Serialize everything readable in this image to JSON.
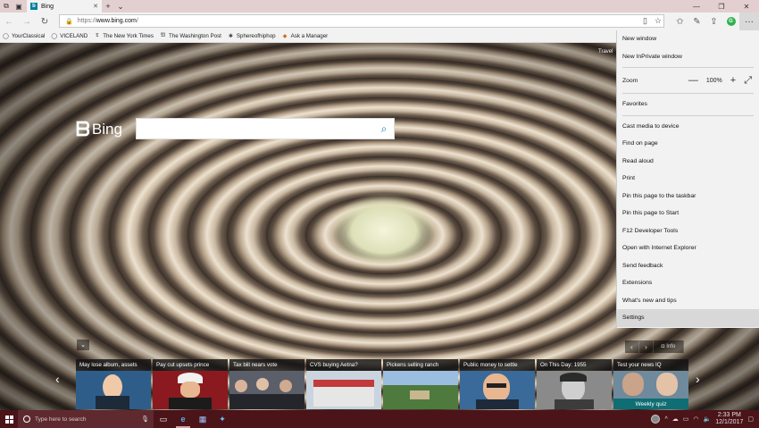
{
  "browser": {
    "tab": {
      "title": "Bing"
    },
    "address": {
      "proto": "https://",
      "host": "www.bing.com",
      "path": "/"
    },
    "favorites": [
      {
        "label": "YourClassical",
        "icon": "globe-icon"
      },
      {
        "label": "VICELAND",
        "icon": "globe-icon"
      },
      {
        "label": "The New York Times",
        "icon": "nyt-icon"
      },
      {
        "label": "The Washington Post",
        "icon": "wapo-icon"
      },
      {
        "label": "Sphereofhiphop",
        "icon": "star-icon"
      },
      {
        "label": "Ask a Manager",
        "icon": "ask-manager-icon"
      }
    ]
  },
  "bing": {
    "logo_text": "Bing",
    "search_placeholder": "",
    "travel_label": "Travel",
    "info_label": "Info",
    "news": [
      {
        "title": "May lose album, assets",
        "bg": "#2e5d8a",
        "accent": "#f0c9a8"
      },
      {
        "title": "Pay cut upsets prince",
        "bg": "#8a1a1f",
        "accent": "#d9d9d9"
      },
      {
        "title": "Tax bill nears vote",
        "bg": "#5b5f6a",
        "accent": "#2b2b2b"
      },
      {
        "title": "CVS buying Aetna?",
        "bg": "#c23a3a",
        "accent": "#e8e8e8"
      },
      {
        "title": "Pickens selling ranch",
        "bg": "#4e7a3e",
        "accent": "#9bbde0"
      },
      {
        "title": "Public money to settle",
        "bg": "#3a6a9a",
        "accent": "#e8b690"
      },
      {
        "title": "On This Day: 1955",
        "bg": "#8a8a8a",
        "accent": "#3c3c3c"
      },
      {
        "title": "Test your news IQ",
        "bg": "#6f8a9c",
        "accent": "#c9a48a"
      }
    ],
    "quiz_badge": "Weekly quiz"
  },
  "menu": {
    "group1": [
      "New window",
      "New InPrivate window"
    ],
    "zoom_label": "Zoom",
    "zoom_value": "100%",
    "favorites": "Favorites",
    "group2": [
      "Cast media to device",
      "Find on page",
      "Read aloud",
      "Print",
      "Pin this page to the taskbar",
      "Pin this page to Start",
      "F12 Developer Tools",
      "Open with Internet Explorer",
      "Send feedback",
      "Extensions",
      "What's new and tips",
      "Settings"
    ],
    "highlighted": "Settings"
  },
  "taskbar": {
    "search_placeholder": "Type here to search",
    "time": "2:33 PM",
    "date": "12/1/2017"
  },
  "colors": {
    "taskbar": "#4a1419",
    "tabbar": "#e3cfd0",
    "bing_accent": "#0a7ebd",
    "quiz_badge": "#0e6e74"
  }
}
